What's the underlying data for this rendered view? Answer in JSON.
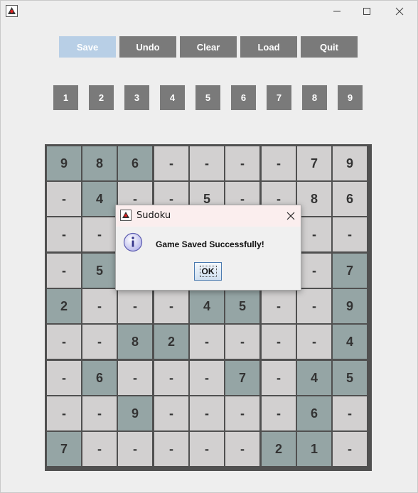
{
  "window": {
    "icon": "java-duke-icon",
    "controls": {
      "minimize": "minimize-icon",
      "maximize": "maximize-icon",
      "close": "close-icon"
    }
  },
  "toolbar": {
    "save_label": "Save",
    "undo_label": "Undo",
    "clear_label": "Clear",
    "load_label": "Load",
    "quit_label": "Quit"
  },
  "numpad": [
    "1",
    "2",
    "3",
    "4",
    "5",
    "6",
    "7",
    "8",
    "9"
  ],
  "board": {
    "rows": [
      [
        {
          "v": "9",
          "g": true
        },
        {
          "v": "8",
          "g": true
        },
        {
          "v": "6",
          "g": true
        },
        {
          "v": "-",
          "g": false
        },
        {
          "v": "-",
          "g": false
        },
        {
          "v": "-",
          "g": false
        },
        {
          "v": "-",
          "g": false
        },
        {
          "v": "7",
          "g": false
        },
        {
          "v": "9",
          "g": false
        }
      ],
      [
        {
          "v": "-",
          "g": false
        },
        {
          "v": "4",
          "g": true
        },
        {
          "v": "-",
          "g": false
        },
        {
          "v": "-",
          "g": false
        },
        {
          "v": "5",
          "g": false
        },
        {
          "v": "-",
          "g": false
        },
        {
          "v": "-",
          "g": false
        },
        {
          "v": "8",
          "g": false
        },
        {
          "v": "6",
          "g": false
        }
      ],
      [
        {
          "v": "-",
          "g": false
        },
        {
          "v": "-",
          "g": false
        },
        {
          "v": "-",
          "g": false
        },
        {
          "v": "-",
          "g": false
        },
        {
          "v": "-",
          "g": false
        },
        {
          "v": "-",
          "g": false
        },
        {
          "v": "-",
          "g": false
        },
        {
          "v": "-",
          "g": false
        },
        {
          "v": "-",
          "g": false
        }
      ],
      [
        {
          "v": "-",
          "g": false
        },
        {
          "v": "5",
          "g": true
        },
        {
          "v": "-",
          "g": false
        },
        {
          "v": "-",
          "g": false
        },
        {
          "v": "-",
          "g": false
        },
        {
          "v": "-",
          "g": false
        },
        {
          "v": "-",
          "g": false
        },
        {
          "v": "-",
          "g": false
        },
        {
          "v": "7",
          "g": true
        }
      ],
      [
        {
          "v": "2",
          "g": true
        },
        {
          "v": "-",
          "g": false
        },
        {
          "v": "-",
          "g": false
        },
        {
          "v": "-",
          "g": false
        },
        {
          "v": "4",
          "g": true
        },
        {
          "v": "5",
          "g": true
        },
        {
          "v": "-",
          "g": false
        },
        {
          "v": "-",
          "g": false
        },
        {
          "v": "9",
          "g": true
        }
      ],
      [
        {
          "v": "-",
          "g": false
        },
        {
          "v": "-",
          "g": false
        },
        {
          "v": "8",
          "g": true
        },
        {
          "v": "2",
          "g": true
        },
        {
          "v": "-",
          "g": false
        },
        {
          "v": "-",
          "g": false
        },
        {
          "v": "-",
          "g": false
        },
        {
          "v": "-",
          "g": false
        },
        {
          "v": "4",
          "g": true
        }
      ],
      [
        {
          "v": "-",
          "g": false
        },
        {
          "v": "6",
          "g": true
        },
        {
          "v": "-",
          "g": false
        },
        {
          "v": "-",
          "g": false
        },
        {
          "v": "-",
          "g": false
        },
        {
          "v": "7",
          "g": true
        },
        {
          "v": "-",
          "g": false
        },
        {
          "v": "4",
          "g": true
        },
        {
          "v": "5",
          "g": true
        }
      ],
      [
        {
          "v": "-",
          "g": false
        },
        {
          "v": "-",
          "g": false
        },
        {
          "v": "9",
          "g": true
        },
        {
          "v": "-",
          "g": false
        },
        {
          "v": "-",
          "g": false
        },
        {
          "v": "-",
          "g": false
        },
        {
          "v": "-",
          "g": false
        },
        {
          "v": "6",
          "g": true
        },
        {
          "v": "-",
          "g": false
        }
      ],
      [
        {
          "v": "7",
          "g": true
        },
        {
          "v": "-",
          "g": false
        },
        {
          "v": "-",
          "g": false
        },
        {
          "v": "-",
          "g": false
        },
        {
          "v": "-",
          "g": false
        },
        {
          "v": "-",
          "g": false
        },
        {
          "v": "2",
          "g": true
        },
        {
          "v": "1",
          "g": true
        },
        {
          "v": "-",
          "g": false
        }
      ]
    ]
  },
  "dialog": {
    "title": "Sudoku",
    "message": "Game Saved Successfully!",
    "ok_label": "OK",
    "icon": "information-icon"
  },
  "colors": {
    "button_bg": "#7a7a7a",
    "save_button_bg": "#b8cfe6",
    "given_cell": "#95a5a5",
    "empty_cell": "#d2d0d0",
    "grid_line": "#505050"
  }
}
